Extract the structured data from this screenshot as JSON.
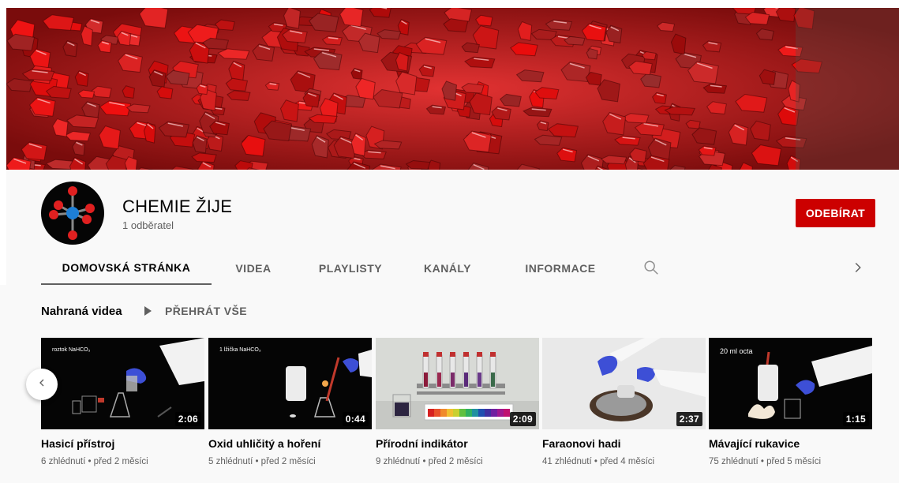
{
  "channel": {
    "name": "CHEMIE ŽIJE",
    "subscribers": "1 odběratel",
    "subscribe_label": "ODEBÍRAT"
  },
  "tabs": [
    {
      "label": "DOMOVSKÁ STRÁNKA",
      "active": true
    },
    {
      "label": "VIDEA",
      "active": false
    },
    {
      "label": "PLAYLISTY",
      "active": false
    },
    {
      "label": "KANÁLY",
      "active": false
    },
    {
      "label": "INFORMACE",
      "active": false
    }
  ],
  "tab_icons": {
    "search": "search-icon",
    "next": "chevron-right-icon"
  },
  "shelf": {
    "title": "Nahraná videa",
    "play_all_label": "PŘEHRÁT VŠE",
    "prev_icon": "chevron-left-icon"
  },
  "videos": [
    {
      "title": "Hasicí přístroj",
      "meta": "6 zhlédnutí • před 2 měsíci",
      "duration": "2:06",
      "caption": "roztok NaHCO₃"
    },
    {
      "title": "Oxid uhličitý a hoření",
      "meta": "5 zhlédnutí • před 2 měsíci",
      "duration": "0:44",
      "caption": "1 lžička NaHCO₃"
    },
    {
      "title": "Přírodní indikátor",
      "meta": "9 zhlédnutí • před 2 měsíci",
      "duration": "2:09",
      "caption": ""
    },
    {
      "title": "Faraonovi hadi",
      "meta": "41 zhlédnutí • před 4 měsíci",
      "duration": "2:37",
      "caption": ""
    },
    {
      "title": "Mávající rukavice",
      "meta": "75 zhlédnutí • před 5 měsíci",
      "duration": "1:15",
      "caption": "20 ml octa"
    }
  ],
  "colors": {
    "subscribe": "#cc0000",
    "banner": "#b81a1a",
    "background": "#f9f9f9"
  }
}
